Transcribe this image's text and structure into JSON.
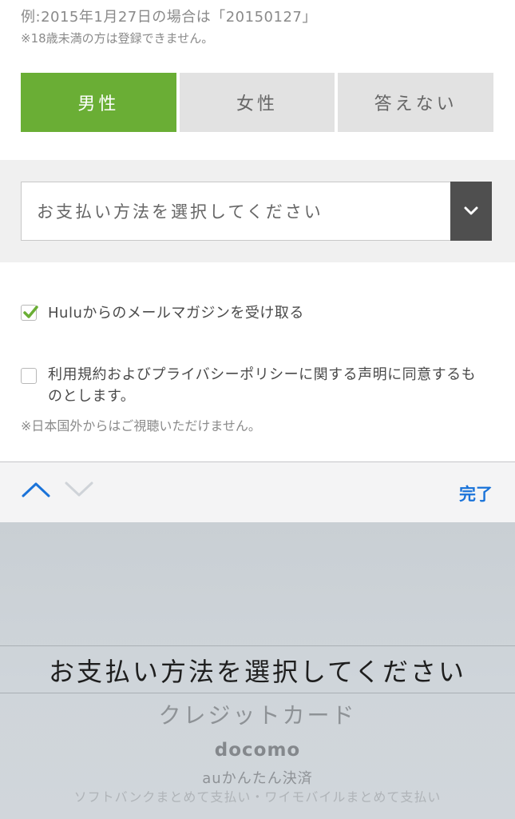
{
  "form": {
    "birthdate_hint": "例:2015年1月27日の場合は「20150127」",
    "age_notice": "※18歳未満の方は登録できません。",
    "gender": {
      "options": [
        "男性",
        "女性",
        "答えない"
      ],
      "selected": "男性"
    },
    "payment": {
      "select_label": "お支払い方法を選択してください",
      "arrow_icon": "chevron-down-icon"
    },
    "newsletter": {
      "label": "Huluからのメールマガジンを受け取る",
      "checked": true
    },
    "terms": {
      "label": "利用規約およびプライバシーポリシーに関する声明に同意するものとします。",
      "checked": false
    },
    "region_notice": "※日本国外からはご視聴いただけません。"
  },
  "toolbar": {
    "prev_icon": "chevron-up-icon",
    "next_icon": "chevron-down-icon",
    "done_label": "完了"
  },
  "picker": {
    "options": [
      "お支払い方法を選択してください",
      "クレジットカード",
      "docomo",
      "auかんたん決済",
      "ソフトバンクまとめて支払い・ワイモバイルまとめて支払い"
    ],
    "selected_index": 0
  },
  "colors": {
    "accent_green": "#6aae35",
    "ios_blue": "#1a73d9",
    "select_arrow_bg": "#4f4f4f"
  }
}
